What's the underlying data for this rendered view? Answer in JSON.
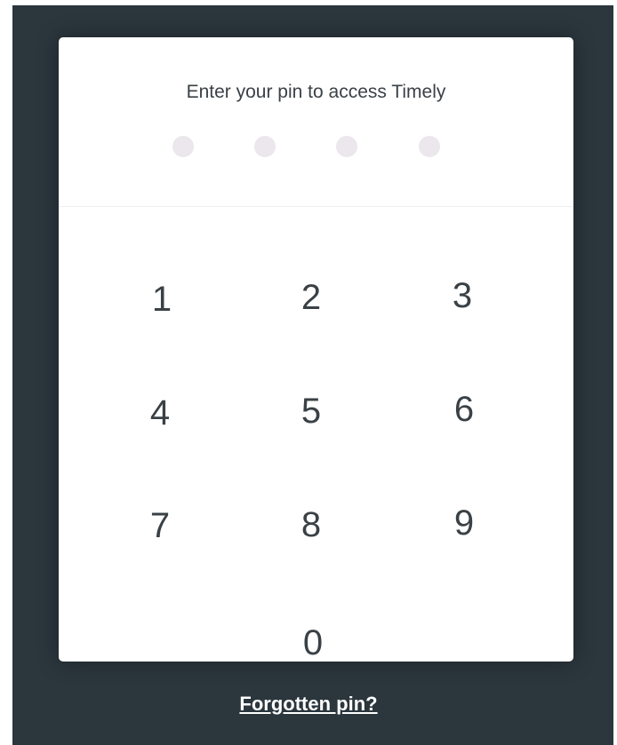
{
  "prompt": "Enter your pin to access Timely",
  "pin": {
    "length": 4,
    "entered": 0
  },
  "keypad": {
    "keys": [
      "1",
      "2",
      "3",
      "4",
      "5",
      "6",
      "7",
      "8",
      "9",
      "0"
    ]
  },
  "forgot_link": "Forgotten pin?",
  "colors": {
    "backdrop": "#2b363d",
    "card": "#ffffff",
    "text": "#3a4146",
    "pin_dot_empty": "#ebe7ec",
    "link": "#ffffff"
  }
}
